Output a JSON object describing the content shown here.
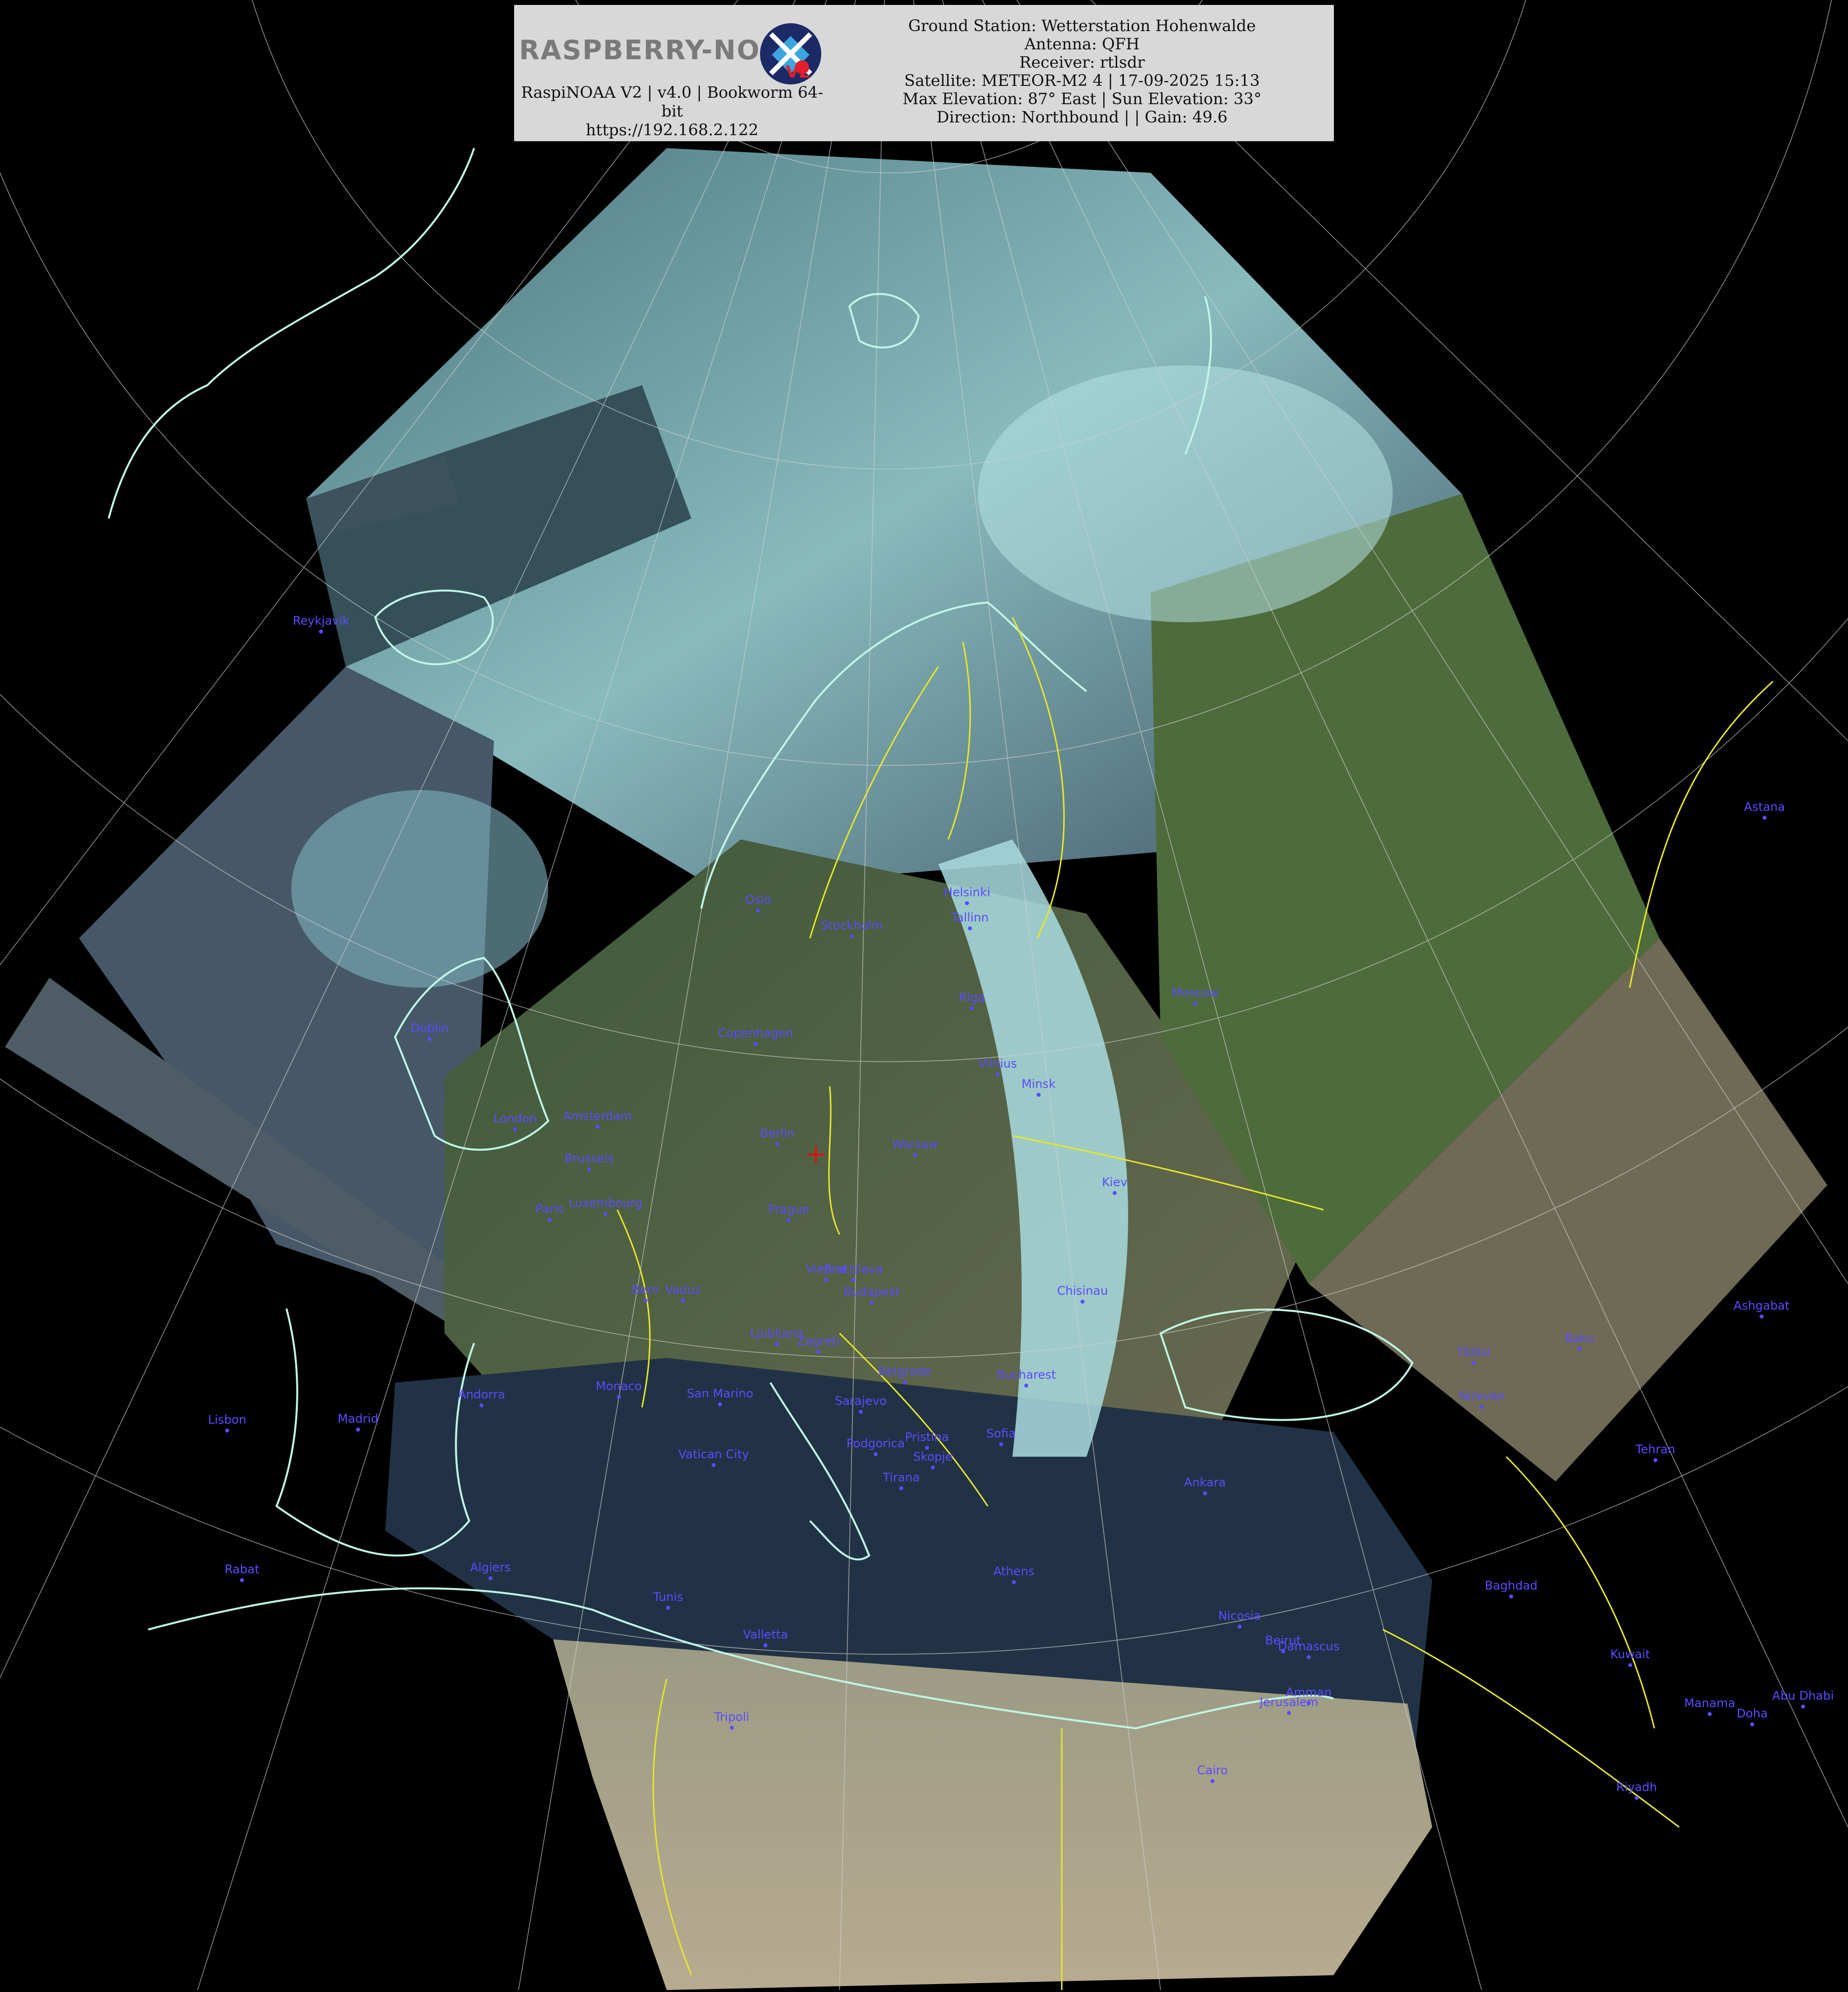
{
  "header": {
    "logo_text": "RASPBERRY-NOAA",
    "logo_badge": "V2",
    "left_lines": [
      "RaspiNOAA V2 | v4.0 | Bookworm 64-",
      "bit",
      "https://192.168.2.122"
    ],
    "right_lines": [
      "Ground Station: Wetterstation Hohenwalde",
      "Antenna: QFH",
      "Receiver: rtlsdr",
      "Satellite: METEOR-M2 4 | 17-09-2025 15:13",
      "Max Elevation: 87° East | Sun Elevation: 33°",
      "Direction: Northbound | | Gain: 49.6"
    ]
  },
  "colors": {
    "coastline": "#bff5e6",
    "border": "#e6e62a",
    "grid": "#cfcfcf",
    "city": "#5b4bff",
    "ground_station_marker": "#e01010",
    "ocean": "#2a3b4a",
    "cloud": "#a9dce0",
    "land": "#4f6a3c"
  },
  "icons": {
    "logo": "satellite-raspberry-logo-icon",
    "ground_station": "crosshair-icon"
  },
  "cities": [
    {
      "name": "Reykjavik"
    },
    {
      "name": "Oslo"
    },
    {
      "name": "Stockholm"
    },
    {
      "name": "Helsinki"
    },
    {
      "name": "Tallinn"
    },
    {
      "name": "Riga"
    },
    {
      "name": "Moscow"
    },
    {
      "name": "Dublin"
    },
    {
      "name": "Copenhagen"
    },
    {
      "name": "Vilnius"
    },
    {
      "name": "Minsk"
    },
    {
      "name": "London"
    },
    {
      "name": "Amsterdam"
    },
    {
      "name": "Berlin"
    },
    {
      "name": "Warsaw"
    },
    {
      "name": "Brussels"
    },
    {
      "name": "Kiev"
    },
    {
      "name": "Paris"
    },
    {
      "name": "Luxembourg"
    },
    {
      "name": "Prague"
    },
    {
      "name": "Vienna"
    },
    {
      "name": "Bratislava"
    },
    {
      "name": "Bern"
    },
    {
      "name": "Vaduz"
    },
    {
      "name": "Budapest"
    },
    {
      "name": "Chisinau"
    },
    {
      "name": "Ljubljana"
    },
    {
      "name": "Zagreb"
    },
    {
      "name": "Belgrade"
    },
    {
      "name": "Bucharest"
    },
    {
      "name": "Andorra"
    },
    {
      "name": "Monaco"
    },
    {
      "name": "San Marino"
    },
    {
      "name": "Sarajevo"
    },
    {
      "name": "Lisbon"
    },
    {
      "name": "Madrid"
    },
    {
      "name": "Sofia"
    },
    {
      "name": "Podgorica"
    },
    {
      "name": "Pristina"
    },
    {
      "name": "Skopje"
    },
    {
      "name": "Vatican City"
    },
    {
      "name": "Tirana"
    },
    {
      "name": "Tbilisi"
    },
    {
      "name": "Baku"
    },
    {
      "name": "Yerevan"
    },
    {
      "name": "Astana"
    },
    {
      "name": "Ashgabat"
    },
    {
      "name": "Tehran"
    },
    {
      "name": "Ankara"
    },
    {
      "name": "Rabat"
    },
    {
      "name": "Algiers"
    },
    {
      "name": "Tunis"
    },
    {
      "name": "Athens"
    },
    {
      "name": "Valletta"
    },
    {
      "name": "Nicosia"
    },
    {
      "name": "Beirut"
    },
    {
      "name": "Damascus"
    },
    {
      "name": "Baghdad"
    },
    {
      "name": "Kuwait"
    },
    {
      "name": "Amman"
    },
    {
      "name": "Jerusalem"
    },
    {
      "name": "Tripoli"
    },
    {
      "name": "Manama"
    },
    {
      "name": "Doha"
    },
    {
      "name": "Abu Dhabi"
    },
    {
      "name": "Cairo"
    },
    {
      "name": "Riyadh"
    }
  ]
}
